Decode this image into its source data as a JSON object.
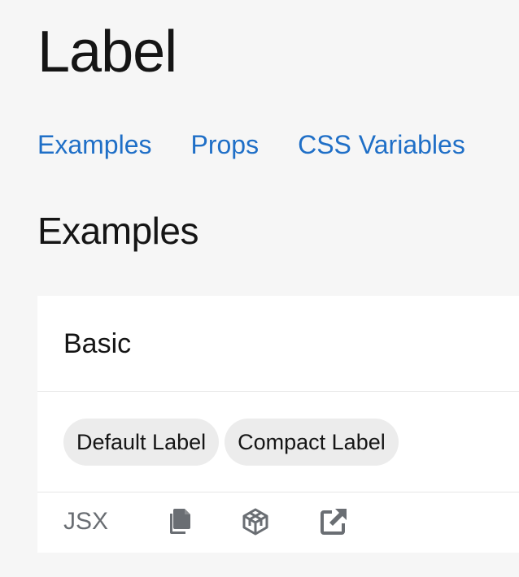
{
  "page": {
    "title": "Label"
  },
  "jump_links": [
    {
      "label": "Examples"
    },
    {
      "label": "Props"
    },
    {
      "label": "CSS Variables"
    }
  ],
  "section": {
    "title": "Examples"
  },
  "example": {
    "title": "Basic",
    "labels": [
      {
        "text": "Default Label"
      },
      {
        "text": "Compact Label"
      }
    ],
    "toolbar": {
      "language": "JSX",
      "icons": [
        "copy-icon",
        "codesandbox-icon",
        "external-link-icon"
      ]
    }
  },
  "colors": {
    "background": "#f6f6f6",
    "link": "#1f6fc7",
    "label_bg": "#ececec",
    "icon": "#6a6e73"
  }
}
